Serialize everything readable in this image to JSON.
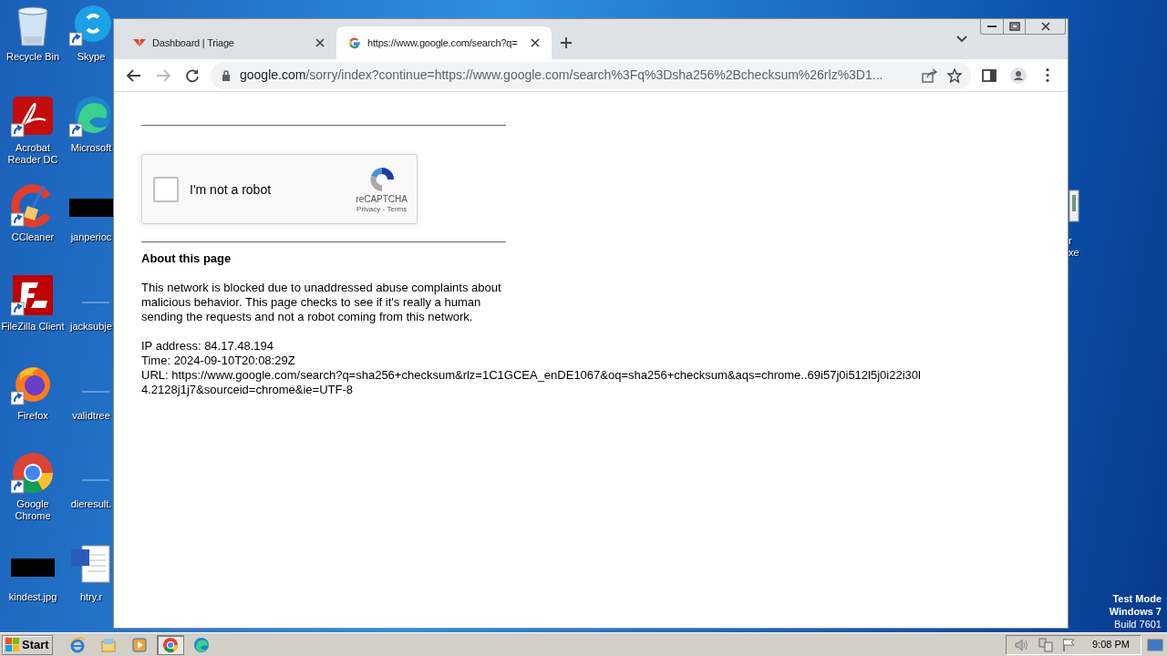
{
  "desktop": {
    "icons": [
      {
        "label": "Recycle Bin",
        "kind": "recycle-bin",
        "shortcut": false
      },
      {
        "label": "Skype",
        "kind": "skype",
        "shortcut": true
      },
      {
        "label": "Acrobat Reader DC",
        "kind": "pdf",
        "shortcut": true
      },
      {
        "label": "Microsoft",
        "kind": "edge",
        "shortcut": true
      },
      {
        "label": "CCleaner",
        "kind": "ccleaner",
        "shortcut": true
      },
      {
        "label": "janperioc",
        "kind": "black-thumb",
        "shortcut": false
      },
      {
        "label": "FileZilla Client",
        "kind": "filezilla",
        "shortcut": true
      },
      {
        "label": "jacksubje",
        "kind": "blank",
        "shortcut": false
      },
      {
        "label": "Firefox",
        "kind": "firefox",
        "shortcut": true
      },
      {
        "label": "validtree",
        "kind": "blank",
        "shortcut": false
      },
      {
        "label": "Google Chrome",
        "kind": "chrome",
        "shortcut": true
      },
      {
        "label": "dieresult.",
        "kind": "blank",
        "shortcut": false
      },
      {
        "label": "kindest.jpg",
        "kind": "black-thumb",
        "shortcut": false
      },
      {
        "label": "htry.r",
        "kind": "word",
        "shortcut": false
      }
    ],
    "right_icon_label": [
      "r",
      "xe"
    ],
    "watermark_lines": [
      "Test Mode",
      "Windows 7",
      "Build 7601"
    ]
  },
  "browser": {
    "tabs": [
      {
        "title": "Dashboard | Triage",
        "kind": "triage",
        "selected": false
      },
      {
        "title": "https://www.google.com/search?q=",
        "kind": "google",
        "selected": true
      }
    ],
    "address": {
      "host": "google.com",
      "path": "/sorry/index?continue=https://www.google.com/search%3Fq%3Dsha256%2Bchecksum%26rlz%3D1..."
    },
    "page": {
      "captcha": {
        "label": "I'm not a robot",
        "checked": false,
        "brand": "reCAPTCHA",
        "privacy": "Privacy",
        "separator": " - ",
        "terms": "Terms"
      },
      "heading": "About this page",
      "paragraph": "This network is blocked due to unaddressed abuse complaints about malicious behavior. This page checks to see if it's really a human sending the requests and not a robot coming from this network.",
      "details": [
        "IP address: 84.17.48.194",
        "Time: 2024-09-10T20:08:29Z"
      ],
      "url": "URL: https://www.google.com/search?q=sha256+checksum&rlz=1C1GCEA_enDE1067&oq=sha256+checksum&aqs=chrome..69i57j0i512l5j0i22i30l4.2128j1j7&sourceid=chrome&ie=UTF-8"
    }
  },
  "taskbar": {
    "start": "Start",
    "apps": [
      {
        "kind": "ie",
        "active": false
      },
      {
        "kind": "explorer",
        "active": false
      },
      {
        "kind": "media",
        "active": false
      },
      {
        "kind": "chrome",
        "active": true
      },
      {
        "kind": "edge",
        "active": false
      }
    ],
    "clock": "9:08 PM"
  }
}
